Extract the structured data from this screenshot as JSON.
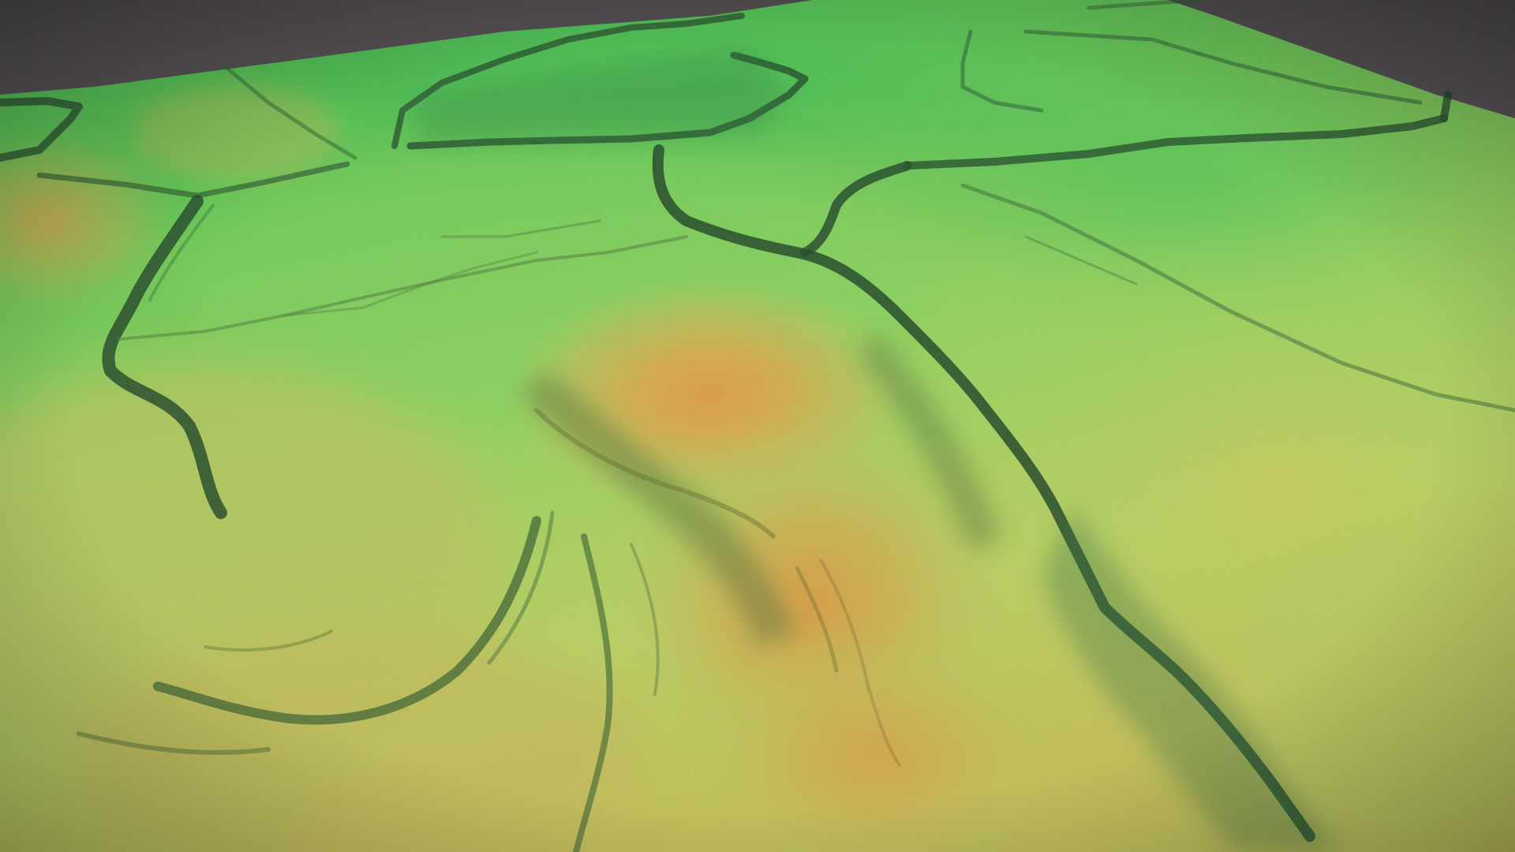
{
  "scene": {
    "kind": "3d-lidar-terrain-render",
    "colors": {
      "background_top": "#4f4b4e",
      "background_bottom": "#8c8488",
      "low_elevation": "#2fb04a",
      "mid_low_elevation": "#7ccf4e",
      "mid_elevation": "#b8cf5a",
      "high_elevation": "#c9a443",
      "peak_elevation": "#d99a3d",
      "ditch_shadow": "#1f4a25",
      "slope_shadow": "#3d5a2a"
    },
    "features": [
      "field-boundary-ditches",
      "central-hill",
      "curving-embankments",
      "riverbank-channel",
      "woodland-patch"
    ]
  }
}
